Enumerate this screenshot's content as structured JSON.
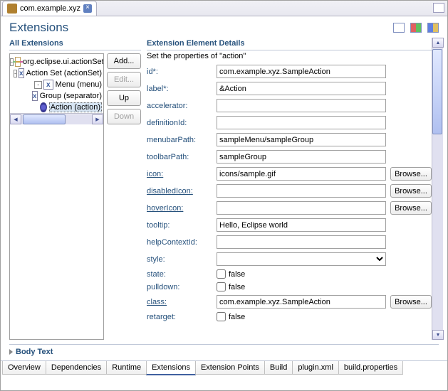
{
  "top_tab": {
    "label": "com.example.xyz"
  },
  "page_title": "Extensions",
  "left": {
    "title": "All Extensions",
    "tree": [
      {
        "level": 0,
        "twisty": "-",
        "icon": "ext",
        "label": "org.eclipse.ui.actionSets"
      },
      {
        "level": 1,
        "twisty": "-",
        "icon": "x",
        "label": "Action Set (actionSet)"
      },
      {
        "level": 2,
        "twisty": "-",
        "icon": "x",
        "label": "Menu (menu)"
      },
      {
        "level": 3,
        "twisty": "",
        "icon": "x",
        "label": "Group (separator)"
      },
      {
        "level": 3,
        "twisty": "",
        "icon": "act",
        "label": "Action (action)",
        "selected": true
      }
    ],
    "buttons": {
      "add": "Add...",
      "edit": "Edit...",
      "up": "Up",
      "down": "Down"
    }
  },
  "right": {
    "title": "Extension Element Details",
    "subtitle": "Set the properties of \"action\"",
    "browse_label": "Browse...",
    "fields": {
      "id": {
        "label": "id*:",
        "value": "com.example.xyz.SampleAction"
      },
      "label": {
        "label": "label*:",
        "value": "&Action"
      },
      "accelerator": {
        "label": "accelerator:",
        "value": ""
      },
      "definitionId": {
        "label": "definitionId:",
        "value": ""
      },
      "menubarPath": {
        "label": "menubarPath:",
        "value": "sampleMenu/sampleGroup"
      },
      "toolbarPath": {
        "label": "toolbarPath:",
        "value": "sampleGroup"
      },
      "icon": {
        "label": "icon:",
        "value": "icons/sample.gif",
        "browse": true,
        "link": true
      },
      "disabledIcon": {
        "label": "disabledIcon:",
        "value": "",
        "browse": true,
        "link": true
      },
      "hoverIcon": {
        "label": "hoverIcon:",
        "value": "",
        "browse": true,
        "link": true
      },
      "tooltip": {
        "label": "tooltip:",
        "value": "Hello, Eclipse world"
      },
      "helpContextId": {
        "label": "helpContextId:",
        "value": ""
      },
      "style": {
        "label": "style:",
        "value": "",
        "type": "select"
      },
      "state": {
        "label": "state:",
        "value": "false",
        "type": "check"
      },
      "pulldown": {
        "label": "pulldown:",
        "value": "false",
        "type": "check"
      },
      "class": {
        "label": "class:",
        "value": "com.example.xyz.SampleAction",
        "browse": true,
        "link": true
      },
      "retarget": {
        "label": "retarget:",
        "value": "false",
        "type": "check"
      }
    }
  },
  "body_text": "Body Text",
  "bottom_tabs": [
    "Overview",
    "Dependencies",
    "Runtime",
    "Extensions",
    "Extension Points",
    "Build",
    "plugin.xml",
    "build.properties"
  ],
  "bottom_active": "Extensions"
}
